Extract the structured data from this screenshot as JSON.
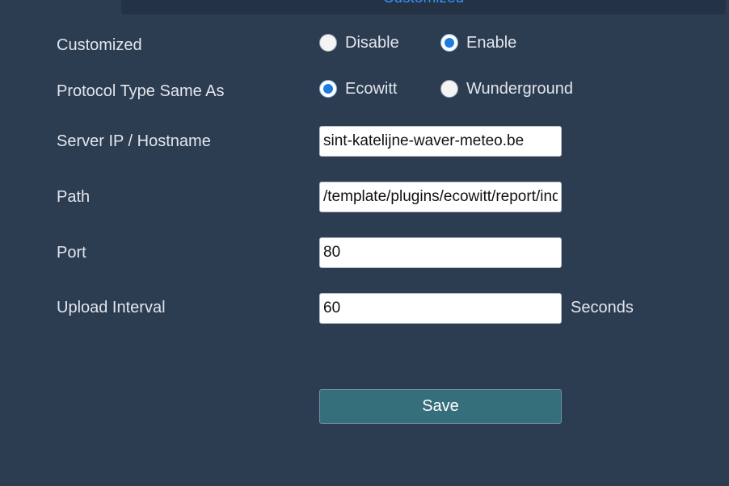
{
  "header": {
    "tab_label": "Customized"
  },
  "form": {
    "customized": {
      "label": "Customized",
      "options": [
        {
          "label": "Disable",
          "checked": false
        },
        {
          "label": "Enable",
          "checked": true
        }
      ]
    },
    "protocol": {
      "label": "Protocol Type Same As",
      "options": [
        {
          "label": "Ecowitt",
          "checked": true
        },
        {
          "label": "Wunderground",
          "checked": false
        }
      ]
    },
    "server": {
      "label": "Server IP / Hostname",
      "value": "sint-katelijne-waver-meteo.be"
    },
    "path": {
      "label": "Path",
      "value": "/template/plugins/ecowitt/report/ind"
    },
    "port": {
      "label": "Port",
      "value": "80"
    },
    "interval": {
      "label": "Upload Interval",
      "value": "60",
      "unit": "Seconds"
    },
    "save_label": "Save"
  },
  "colors": {
    "background": "#2c3c51",
    "accent": "#1e7be0",
    "save_button": "#366f7c"
  }
}
